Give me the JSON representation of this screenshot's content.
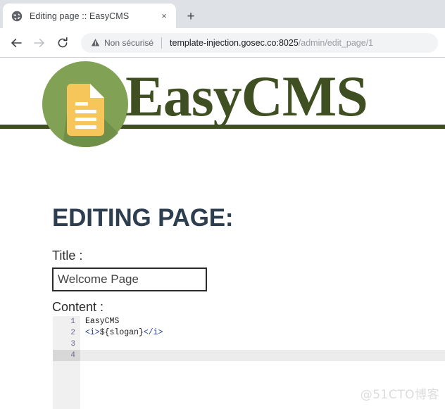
{
  "browser": {
    "tab": {
      "favicon": "globe-icon",
      "title": "Editing page :: EasyCMS",
      "close_label": "×"
    },
    "newtab_label": "+",
    "nav": {
      "back": "back-arrow-icon",
      "forward": "forward-arrow-icon",
      "reload": "reload-icon"
    },
    "omnibox": {
      "security_label": "Non sécurisé",
      "security_icon": "warning-triangle-icon",
      "url_host": "template-injection.gosec.co:8025",
      "url_path": "/admin/edit_page/1"
    }
  },
  "brand": {
    "wordmark": "EasyCMS",
    "logo_icon": "document-page-icon",
    "circle_color": "#81a155",
    "doc_color": "#f7c65b",
    "rule_color": "#3f4f22"
  },
  "main": {
    "heading": "EDITING PAGE:",
    "title_label": "Title :",
    "title_value": "Welcome Page",
    "title_placeholder": "",
    "content_label": "Content :"
  },
  "editor": {
    "gutter": [
      "1",
      "2",
      "3",
      "4"
    ],
    "active_line": 4,
    "lines": [
      {
        "text": "EasyCMS",
        "tokens": [
          {
            "t": "EasyCMS",
            "c": "plain"
          }
        ]
      },
      {
        "text": "<i>${slogan}</i>",
        "tokens": [
          {
            "t": "<i>",
            "c": "tag"
          },
          {
            "t": "${slogan}",
            "c": "expr"
          },
          {
            "t": "</i>",
            "c": "tag"
          }
        ]
      },
      {
        "text": "",
        "tokens": []
      },
      {
        "text": "",
        "tokens": []
      }
    ]
  },
  "watermark": "@51CTO博客"
}
